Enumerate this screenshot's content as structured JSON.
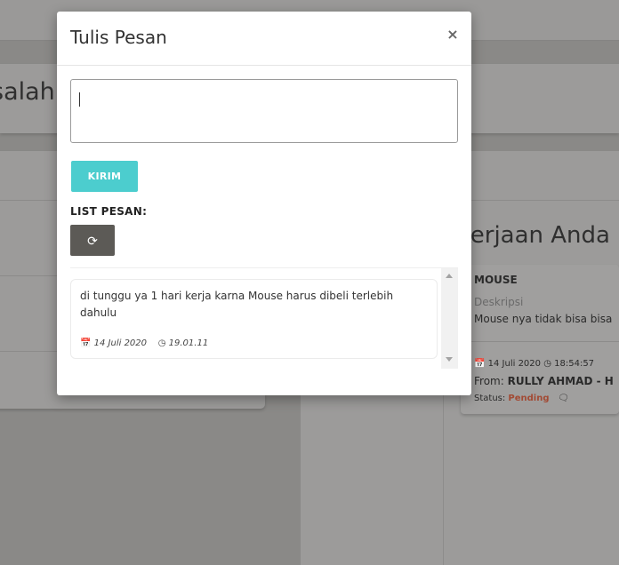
{
  "background": {
    "page_title_fragment": "salah",
    "section_heading": "Kerjaan Anda",
    "task": {
      "title": "MOUSE",
      "description_label": "Deskripsi",
      "description": "Mouse nya tidak bisa bisa",
      "date": "14 Juli 2020",
      "time": "18:54:57",
      "from_label": "From:",
      "from_name": "RULLY AHMAD - H",
      "status_label": "Status:",
      "status_value": "Pending"
    }
  },
  "modal": {
    "title": "Tulis Pesan",
    "close_label": "×",
    "message_input": {
      "value": "",
      "placeholder": ""
    },
    "send_label": "KIRIM",
    "list_label": "LIST PESAN:",
    "refresh_icon": "refresh-icon",
    "messages": [
      {
        "text": "di tunggu ya 1 hari kerja karna Mouse harus dibeli terlebih dahulu",
        "date": "14 Juli 2020",
        "time": "19.01.11"
      }
    ]
  },
  "colors": {
    "send_button": "#4ccdce",
    "refresh_button": "#5c5a56",
    "status_pending": "#a24a34",
    "overlay": "#8a8987"
  }
}
